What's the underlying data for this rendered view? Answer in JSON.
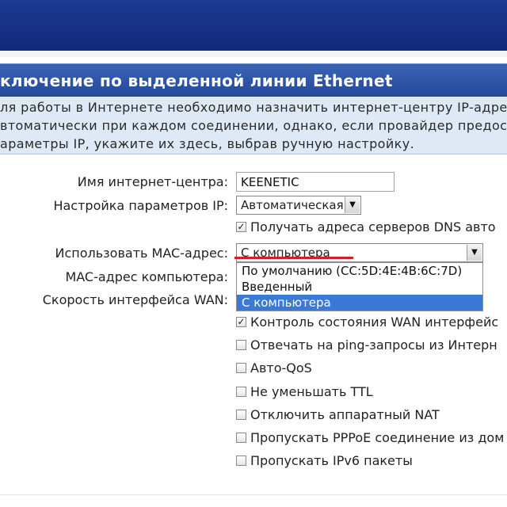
{
  "header": {
    "title": "ключение по выделенной линии Ethernet"
  },
  "description": {
    "lines": [
      "ля работы в Интернете необходимо назначить интернет-центру IP-адрес",
      "втоматически при каждом соединении, однако, если провайдер предоста",
      "араметры IP, укажите их здесь, выбрав ручную настройку."
    ]
  },
  "form": {
    "hostname": {
      "label": "Имя интернет-центра:",
      "value": "KEENETIC"
    },
    "ip_settings": {
      "label": "Настройка параметров IP:",
      "value": "Автоматическая"
    },
    "dns_auto": {
      "label": "Получать адреса серверов DNS авто",
      "checked": true
    },
    "mac_use": {
      "label": "Использовать MAC-адрес:",
      "value": "С компьютера",
      "options": [
        "По умолчанию (CC:5D:4E:4B:6C:7D)",
        "Введенный",
        "С компьютера"
      ],
      "selected_index": 2
    },
    "mac_computer": {
      "label": "MAC-адрес компьютера:"
    },
    "wan_speed": {
      "label": "Скорость интерфейса WAN:"
    },
    "checkboxes": [
      {
        "label": "Контроль состояния WAN интерфейс",
        "checked": true
      },
      {
        "label": "Отвечать на ping-запросы из Интерн",
        "checked": false
      },
      {
        "label": "Авто-QoS",
        "checked": false
      },
      {
        "label": "Не уменьшать TTL",
        "checked": false
      },
      {
        "label": "Отключить аппаратный NAT",
        "checked": false
      },
      {
        "label": "Пропускать PPPoE соединение из дом",
        "checked": false
      },
      {
        "label": "Пропускать IPv6 пакеты",
        "checked": false
      }
    ]
  },
  "colors": {
    "header_blue": "#1c3a92",
    "panel_blue": "#2f55a8",
    "desc_bg": "#dfe8f5",
    "selection": "#3a79d6",
    "annotation_red": "#d0202c"
  },
  "icons": {
    "checkmark": "✓",
    "dropdown_arrow": "▼"
  }
}
